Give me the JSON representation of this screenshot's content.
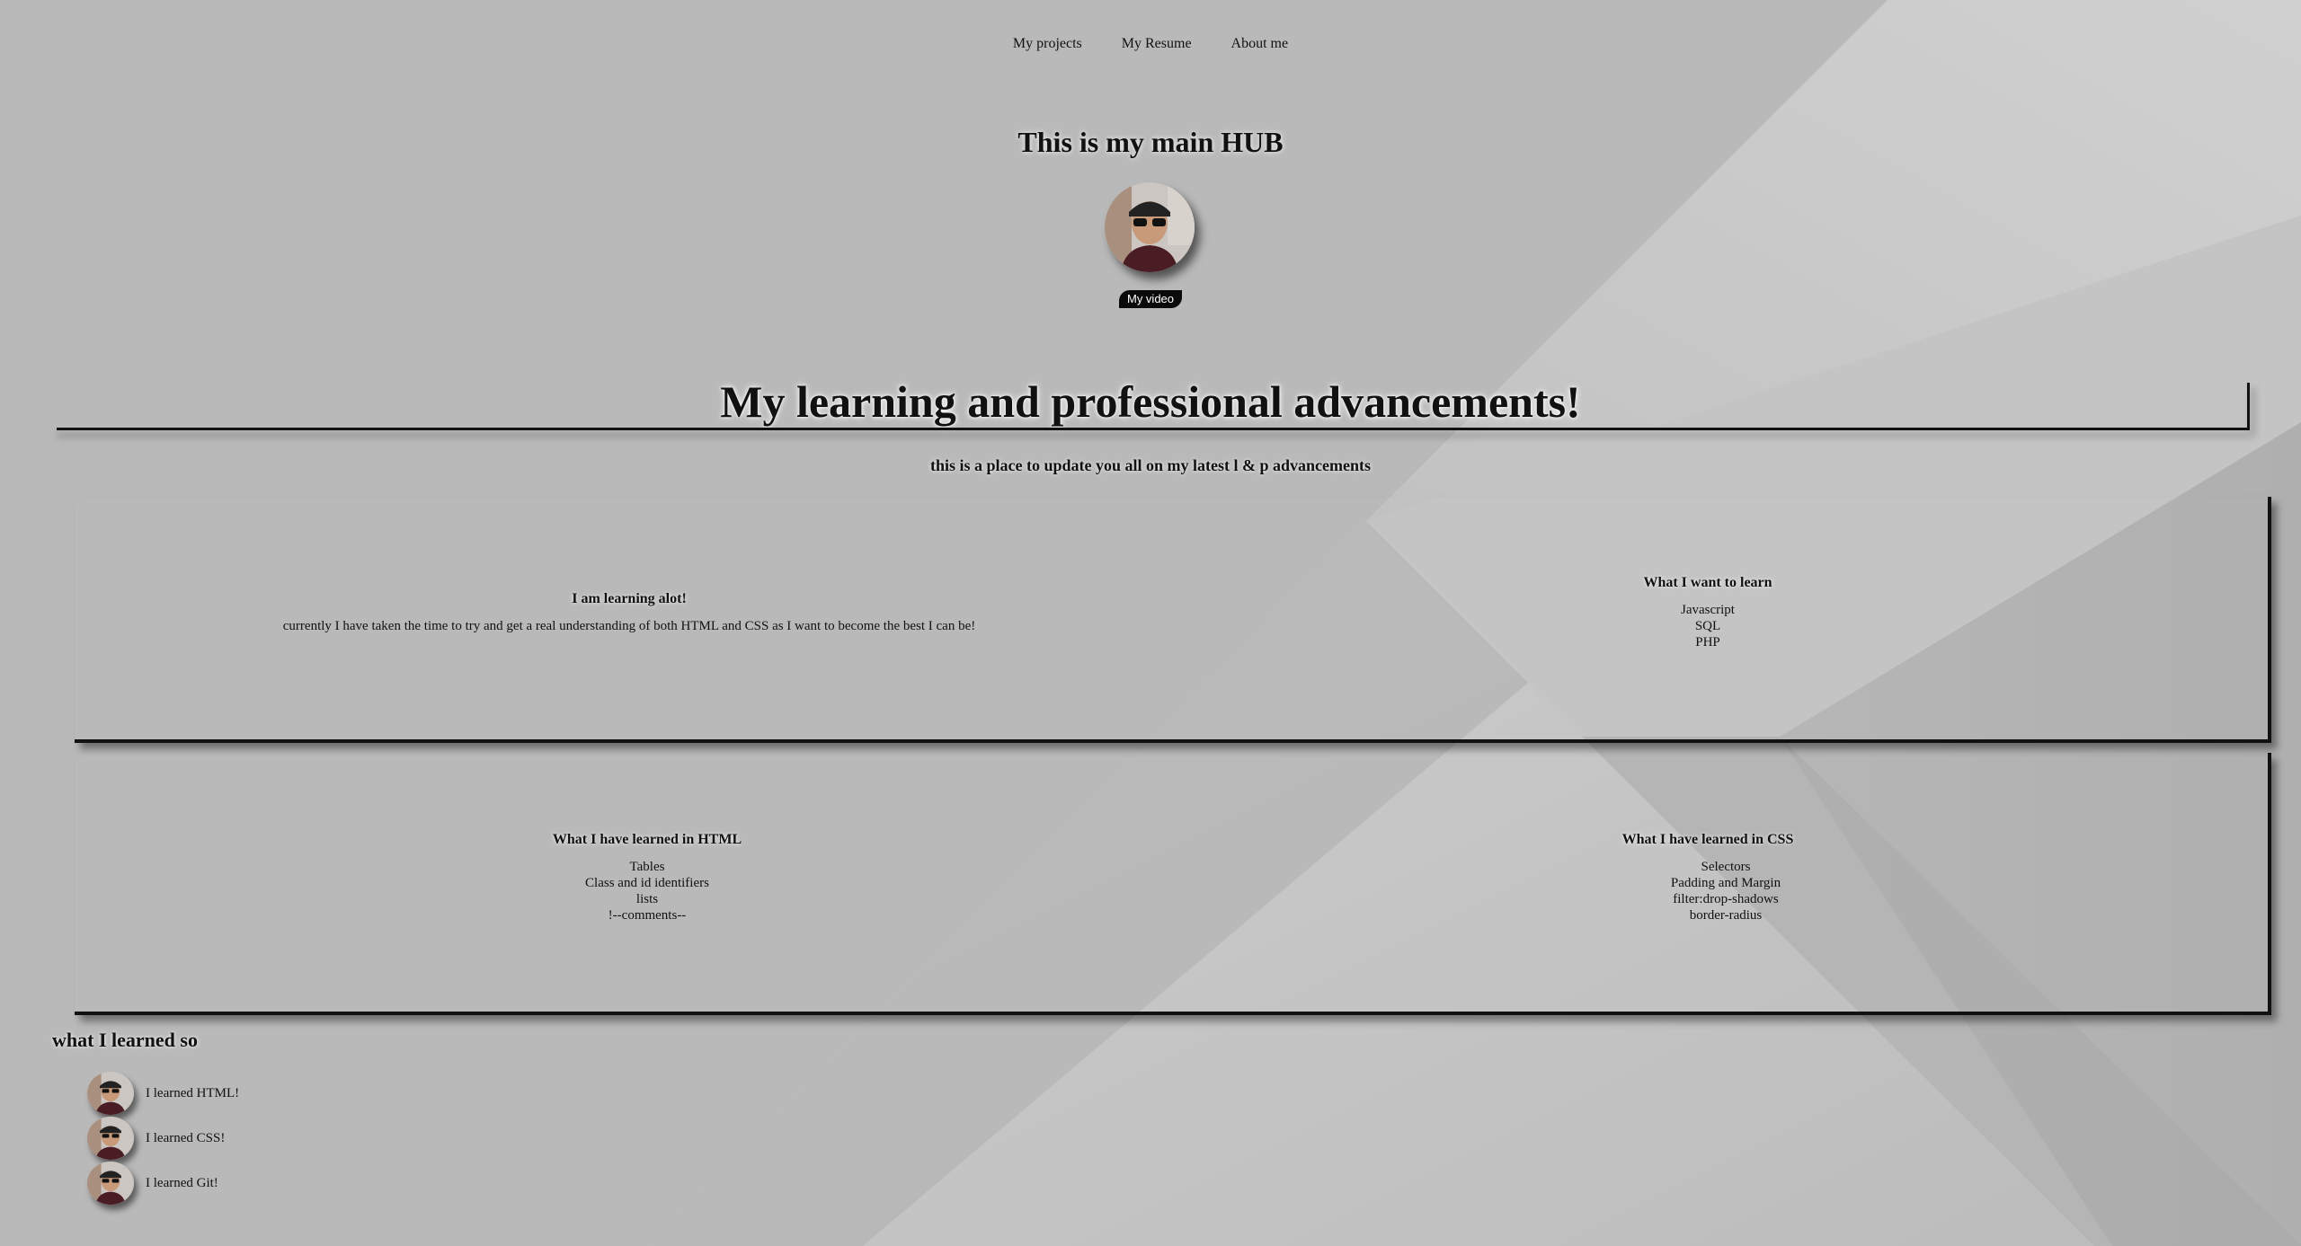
{
  "nav": {
    "items": [
      "My projects",
      "My Resume",
      "About me"
    ]
  },
  "hub": {
    "title": "This is my main HUB",
    "video_button": "My video"
  },
  "advancements": {
    "title": "My learning and professional advancements!",
    "subtitle": "this is a place to update you all on my latest l & p advancements"
  },
  "section1": {
    "left": {
      "heading": "I am learning alot!",
      "text": "currently I have taken the time to try and get a real understanding of both HTML and CSS as I want to become the best I can be!"
    },
    "right": {
      "heading": "What I want to learn",
      "items": [
        "Javascript",
        "SQL",
        "PHP"
      ]
    }
  },
  "section2": {
    "left": {
      "heading": "What I have learned in HTML",
      "items": [
        "Tables",
        "Class and id identifiers",
        "lists",
        "!--comments--"
      ]
    },
    "right": {
      "heading": "What I have learned in CSS",
      "items": [
        "Selectors",
        "Padding and Margin",
        "filter:drop-shadows",
        "border-radius"
      ]
    }
  },
  "learned": {
    "title": "what I learned so",
    "items": [
      "I learned HTML!",
      "I learned CSS!",
      "I learned Git!"
    ]
  },
  "colors": {
    "background": "#b9b9b9",
    "text": "#111111",
    "button_bg": "#0a0a0a",
    "button_text": "#ffffff"
  }
}
